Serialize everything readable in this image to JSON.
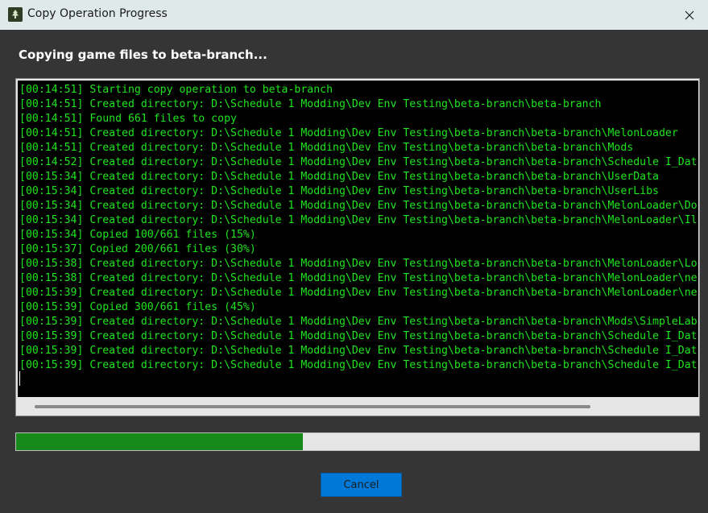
{
  "window": {
    "title": "Copy Operation Progress",
    "icon": "app-logo-icon",
    "close_icon": "close-icon"
  },
  "heading": "Copying game files to beta-branch...",
  "log": {
    "text_color": "#1ee51e",
    "background": "#000000",
    "lines": [
      "[00:14:51] Starting copy operation to beta-branch",
      "[00:14:51] Created directory: D:\\Schedule 1 Modding\\Dev Env Testing\\beta-branch\\beta-branch",
      "[00:14:51] Found 661 files to copy",
      "[00:14:51] Created directory: D:\\Schedule 1 Modding\\Dev Env Testing\\beta-branch\\beta-branch\\MelonLoader",
      "[00:14:51] Created directory: D:\\Schedule 1 Modding\\Dev Env Testing\\beta-branch\\beta-branch\\Mods",
      "[00:14:52] Created directory: D:\\Schedule 1 Modding\\Dev Env Testing\\beta-branch\\beta-branch\\Schedule I_Dat",
      "[00:15:34] Created directory: D:\\Schedule 1 Modding\\Dev Env Testing\\beta-branch\\beta-branch\\UserData",
      "[00:15:34] Created directory: D:\\Schedule 1 Modding\\Dev Env Testing\\beta-branch\\beta-branch\\UserLibs",
      "[00:15:34] Created directory: D:\\Schedule 1 Modding\\Dev Env Testing\\beta-branch\\beta-branch\\MelonLoader\\Do",
      "[00:15:34] Created directory: D:\\Schedule 1 Modding\\Dev Env Testing\\beta-branch\\beta-branch\\MelonLoader\\Il",
      "[00:15:34] Copied 100/661 files (15%)",
      "[00:15:37] Copied 200/661 files (30%)",
      "[00:15:38] Created directory: D:\\Schedule 1 Modding\\Dev Env Testing\\beta-branch\\beta-branch\\MelonLoader\\Lo",
      "[00:15:38] Created directory: D:\\Schedule 1 Modding\\Dev Env Testing\\beta-branch\\beta-branch\\MelonLoader\\ne",
      "[00:15:39] Created directory: D:\\Schedule 1 Modding\\Dev Env Testing\\beta-branch\\beta-branch\\MelonLoader\\ne",
      "[00:15:39] Copied 300/661 files (45%)",
      "[00:15:39] Created directory: D:\\Schedule 1 Modding\\Dev Env Testing\\beta-branch\\beta-branch\\Mods\\SimpleLab",
      "[00:15:39] Created directory: D:\\Schedule 1 Modding\\Dev Env Testing\\beta-branch\\beta-branch\\Schedule I_Dat",
      "[00:15:39] Created directory: D:\\Schedule 1 Modding\\Dev Env Testing\\beta-branch\\beta-branch\\Schedule I_Dat",
      "[00:15:39] Created directory: D:\\Schedule 1 Modding\\Dev Env Testing\\beta-branch\\beta-branch\\Schedule I_Dat"
    ]
  },
  "progress": {
    "percent": 42,
    "fill_color": "#17891b"
  },
  "buttons": {
    "cancel_label": "Cancel",
    "cancel_color": "#0078d7"
  }
}
